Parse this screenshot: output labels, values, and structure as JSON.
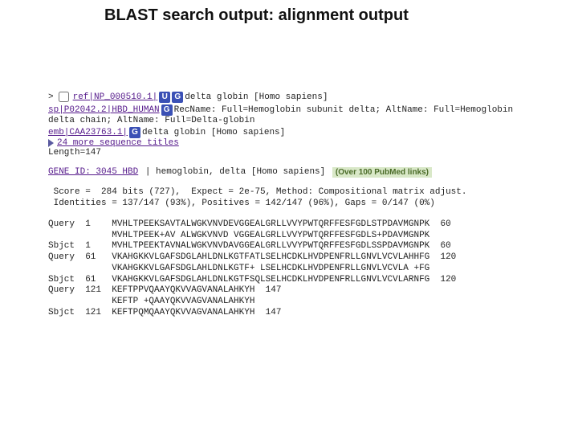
{
  "title": "BLAST search output: alignment output",
  "hit": {
    "ref_accession": "ref|NP_000510.1|",
    "ref_desc": "delta globin [Homo sapiens]",
    "sp_line": "sp|P02042.2|HBD_HUMAN",
    "sp_desc": "RecName: Full=Hemoglobin subunit delta; AltName: Full=Hemoglobin",
    "sp_line2": "delta chain; AltName: Full=Delta-globin",
    "emb_accession": "emb|CAA23763.1|",
    "emb_desc": "delta globin [Homo sapiens]",
    "more_titles": "24 more sequence titles",
    "length": "Length=147",
    "gene_link": "GENE ID: 3045 HBD",
    "gene_desc": " | hemoglobin, delta [Homo sapiens] ",
    "pubmed": "(Over 100 PubMed links)",
    "score_line": " Score =  284 bits (727),  Expect = 2e-75, Method: Compositional matrix adjust.",
    "ident_line": " Identities = 137/147 (93%), Positives = 142/147 (96%), Gaps = 0/147 (0%)",
    "aln": [
      "Query  1    MVHLTPEEKSAVTALWGKVNVDEVGGEALGRLLVVYPWTQRFFESFGDLSTPDAVMGNPK  60",
      "            MVHLTPEEK+AV ALWGKVNVD VGGEALGRLLVVYPWTQRFFESFGDLS+PDAVMGNPK",
      "Sbjct  1    MVHLTPEEKTAVNALWGKVNVDAVGGEALGRLLVVYPWTQRFFESFGDLSSPDAVMGNPK  60",
      "",
      "Query  61   VKAHGKKVLGAFSDGLAHLDNLKGTFATLSELHCDKLHVDPENFRLLGNVLVCVLAHHFG  120",
      "            VKAHGKKVLGAFSDGLAHLDNLKGTF+ LSELHCDKLHVDPENFRLLGNVLVCVLA +FG",
      "Sbjct  61   VKAHGKKVLGAFSDGLAHLDNLKGTFSQLSELHCDKLHVDPENFRLLGNVLVCVLARNFG  120",
      "",
      "Query  121  KEFTPPVQAAYQKVVAGVANALAHKYH  147",
      "            KEFTP +QAAYQKVVAGVANALAHKYH",
      "Sbjct  121  KEFTPQMQAAYQKVVAGVANALAHKYH  147"
    ]
  },
  "icons": {
    "u": "U",
    "g": "G"
  }
}
